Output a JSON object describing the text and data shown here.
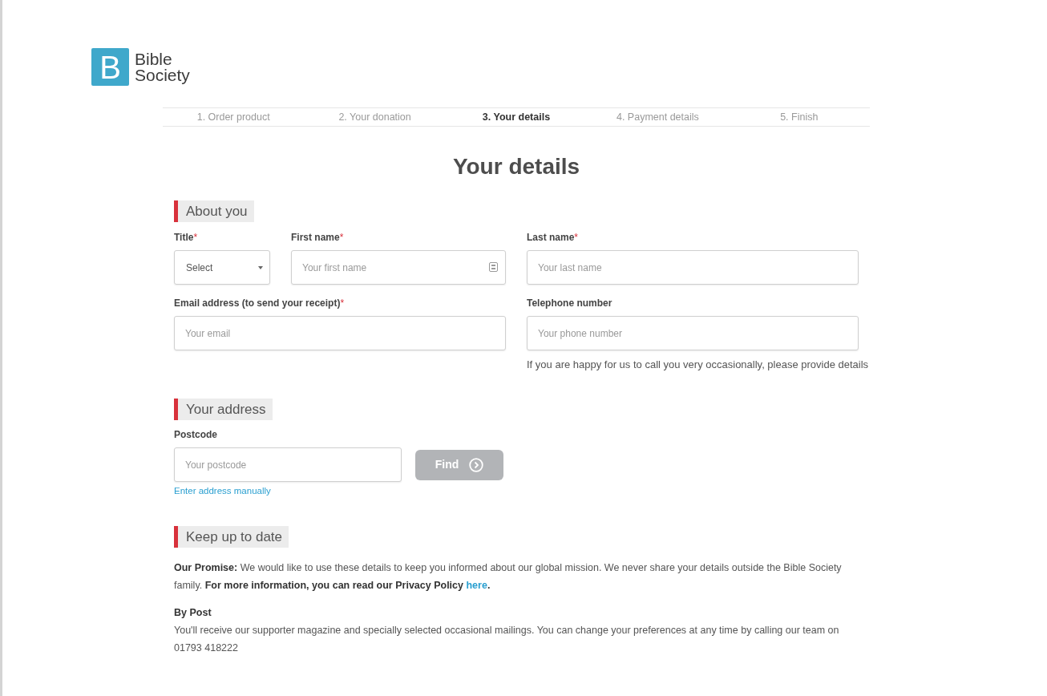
{
  "logo": {
    "mark": "B",
    "name": "Bible Society"
  },
  "steps": [
    {
      "label": "1. Order product",
      "selected": false
    },
    {
      "label": "2. Your donation",
      "selected": false
    },
    {
      "label": "3. Your details",
      "selected": true
    },
    {
      "label": "4. Payment details",
      "selected": false
    },
    {
      "label": "5. Finish",
      "selected": false
    }
  ],
  "heading": "Your details",
  "sections": [
    {
      "kind": "about",
      "title": "About you",
      "fields": [
        {
          "kind": "select",
          "label": "Title",
          "required_mark": "*",
          "value": "Select"
        },
        {
          "kind": "text",
          "label": "First name",
          "required_mark": "*",
          "placeholder": "Your first name",
          "autofill_icon": true
        },
        {
          "kind": "text",
          "label": "Last name",
          "required_mark": "*",
          "placeholder": "Your last name"
        },
        {
          "kind": "text",
          "label": "Email address (to send your receipt)",
          "required_mark": "*",
          "placeholder": "Your email"
        },
        {
          "kind": "text",
          "label": "Telephone number",
          "placeholder": "Your phone number",
          "hint": "If you are happy for us to call you very occasionally, please provide details"
        }
      ]
    },
    {
      "kind": "address",
      "title": "Your address",
      "postcode": {
        "label": "Postcode",
        "placeholder": "Your postcode"
      },
      "find_button": {
        "label": "Find",
        "disabled": true
      },
      "manual_link": "Enter address manually"
    },
    {
      "kind": "updates",
      "title": "Keep up to date",
      "promise": {
        "text": "**Our Promise:** We would like to use these details to keep you informed about our global mission. We never share your details outside the Bible Society family. **For more information, you can read our Privacy Policy** ",
        "link": "here",
        "end": "**.**"
      },
      "by_post": {
        "title": "By Post",
        "text": "You'll receive our supporter magazine and specially selected occasional mailings. You can change your preferences at any time by calling our team on 01793 418222"
      }
    }
  ]
}
